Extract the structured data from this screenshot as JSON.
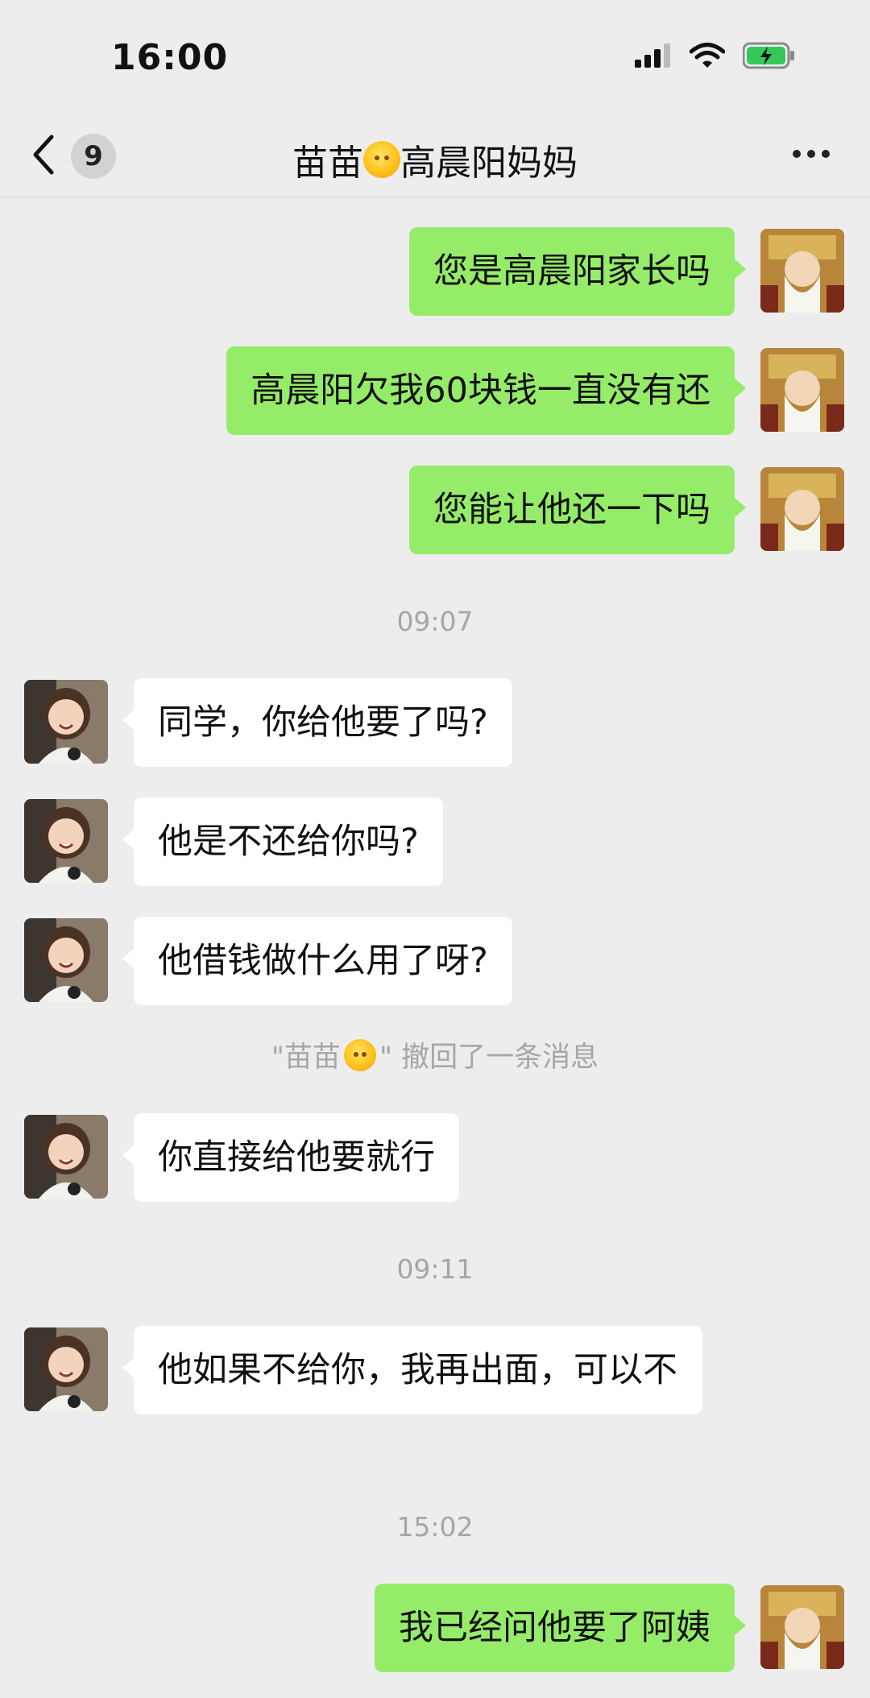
{
  "status_bar": {
    "time": "16:00"
  },
  "nav": {
    "back_badge": "9",
    "title_part1": "苗苗",
    "title_icon": "sun-face-emoji",
    "title_part2": "高晨阳妈妈"
  },
  "messages": [
    {
      "side": "right",
      "text": "您是高晨阳家长吗"
    },
    {
      "side": "right",
      "text": "高晨阳欠我60块钱一直没有还"
    },
    {
      "side": "right",
      "text": "您能让他还一下吗"
    },
    {
      "type": "timestamp",
      "text": "09:07"
    },
    {
      "side": "left",
      "text": "同学，你给他要了吗?"
    },
    {
      "side": "left",
      "text": "他是不还给你吗?"
    },
    {
      "side": "left",
      "text": "他借钱做什么用了呀?"
    },
    {
      "type": "system",
      "prefix": "\"苗苗",
      "icon": "sun-face-emoji",
      "suffix": "\" 撤回了一条消息"
    },
    {
      "side": "left",
      "text": "你直接给他要就行"
    },
    {
      "type": "timestamp",
      "text": "09:11"
    },
    {
      "side": "left",
      "text": "他如果不给你，我再出面，可以不"
    },
    {
      "type": "timestamp",
      "text": "15:02"
    },
    {
      "side": "right",
      "text": "我已经问他要了阿姨"
    }
  ],
  "colors": {
    "background": "#ededed",
    "sent_bubble": "#95ec69",
    "received_bubble": "#ffffff"
  }
}
